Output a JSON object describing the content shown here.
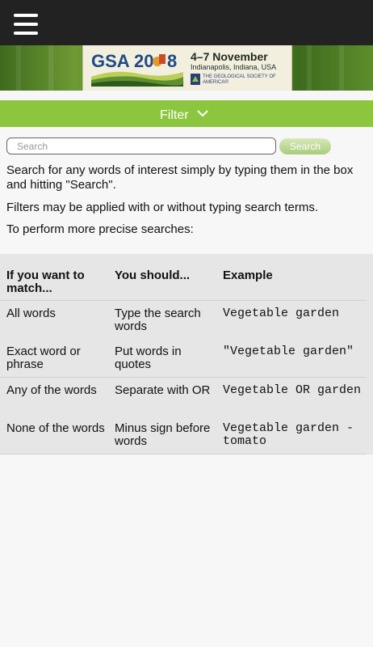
{
  "header": {
    "menu_icon": "hamburger-icon"
  },
  "banner": {
    "logo_text_left": "GSA 20",
    "logo_text_right": "8",
    "dates": "4–7 November",
    "place": "Indianapolis, Indiana, USA",
    "society": "THE GEOLOGICAL SOCIETY OF AMERICA®"
  },
  "filter": {
    "label": "Filter",
    "icon": "chevron-down-icon"
  },
  "search": {
    "placeholder": "Search",
    "value": "",
    "button_label": "Search"
  },
  "help": {
    "paragraph1": "Search for any words of interest simply by typing them in the box and hitting \"Search\".",
    "paragraph2": "Filters may be applied with or without typing search terms.",
    "paragraph3": "To perform more precise searches:"
  },
  "table": {
    "headers": [
      "If you want to match...",
      "You should...",
      "Example"
    ],
    "rows": [
      [
        "All words",
        "Type the search words",
        "Vegetable garden"
      ],
      [
        "Exact word or phrase",
        "Put words in quotes",
        "\"Vegetable garden\""
      ],
      [
        "Any of the words",
        "Separate with OR",
        "Vegetable OR garden"
      ],
      [
        "None of the words",
        "Minus sign before words",
        "Vegetable garden -tomato"
      ]
    ]
  }
}
